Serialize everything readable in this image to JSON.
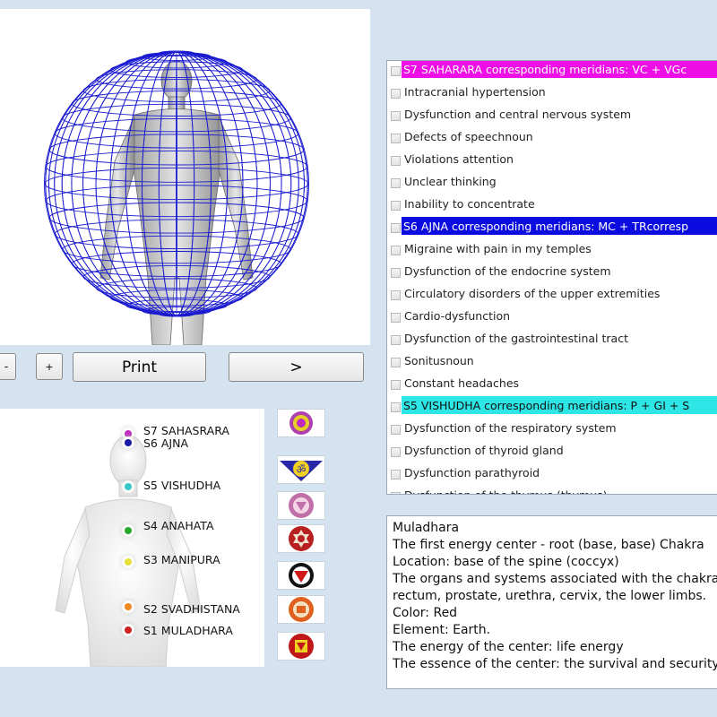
{
  "controls": {
    "minus_label": "-",
    "plus_label": "+",
    "print_label": "Print",
    "next_label": ">"
  },
  "chakras": [
    {
      "label": "S7 SAHASRARA",
      "color": "#c02ac0"
    },
    {
      "label": "S6 AJNA",
      "color": "#1a1aa8"
    },
    {
      "label": "S5 VISHUDHA",
      "color": "#38c8c8"
    },
    {
      "label": "S4 ANAHATA",
      "color": "#2aa82a"
    },
    {
      "label": "S3 MANIPURA",
      "color": "#e8e03a"
    },
    {
      "label": "S2 SVADHISTANA",
      "color": "#f08a20"
    },
    {
      "label": "S1 MULADHARA",
      "color": "#d02020"
    }
  ],
  "checklist": {
    "items": [
      {
        "type": "header",
        "text": "S7 SAHARARA corresponding meridians: VC + VGc",
        "bg": "#ee0ee6",
        "fg": "#ffffff"
      },
      {
        "type": "item",
        "text": "Intracranial hypertension"
      },
      {
        "type": "item",
        "text": "Dysfunction and central nervous system"
      },
      {
        "type": "item",
        "text": "Defects of speechnoun"
      },
      {
        "type": "item",
        "text": "Violations attention"
      },
      {
        "type": "item",
        "text": "Unclear thinking"
      },
      {
        "type": "item",
        "text": "Inability to concentrate"
      },
      {
        "type": "header",
        "text": "S6 AJNA corresponding meridians: MC + TRcorresp",
        "bg": "#0c0ce0",
        "fg": "#ffffff"
      },
      {
        "type": "item",
        "text": "Migraine with pain in my temples"
      },
      {
        "type": "item",
        "text": "Dysfunction of the endocrine system"
      },
      {
        "type": "item",
        "text": "Circulatory disorders of the upper extremities"
      },
      {
        "type": "item",
        "text": "Cardio-dysfunction"
      },
      {
        "type": "item",
        "text": "Dysfunction of the gastrointestinal tract"
      },
      {
        "type": "item",
        "text": "Sonitusnoun"
      },
      {
        "type": "item",
        "text": "Constant headaches"
      },
      {
        "type": "header",
        "text": "S5 VISHUDHA corresponding meridians: P + GI + S",
        "bg": "#2ee6e6",
        "fg": "#111111"
      },
      {
        "type": "item",
        "text": "Dysfunction of the respiratory system"
      },
      {
        "type": "item",
        "text": "Dysfunction of thyroid gland"
      },
      {
        "type": "item",
        "text": "Dysfunction parathyroid"
      },
      {
        "type": "item",
        "text": "Dysfunction of the thymus (thymus)"
      }
    ]
  },
  "description": {
    "lines": [
      "Muladhara",
      "The first energy center - root (base, base) Chakra",
      "Location: base of the spine (coccyx)",
      "The organs and systems associated with the chakra",
      "rectum, prostate, urethra, cervix, the lower limbs.",
      "Color: Red",
      "Element: Earth.",
      "The energy of the center: life energy",
      "The essence of the center: the survival and security"
    ]
  }
}
